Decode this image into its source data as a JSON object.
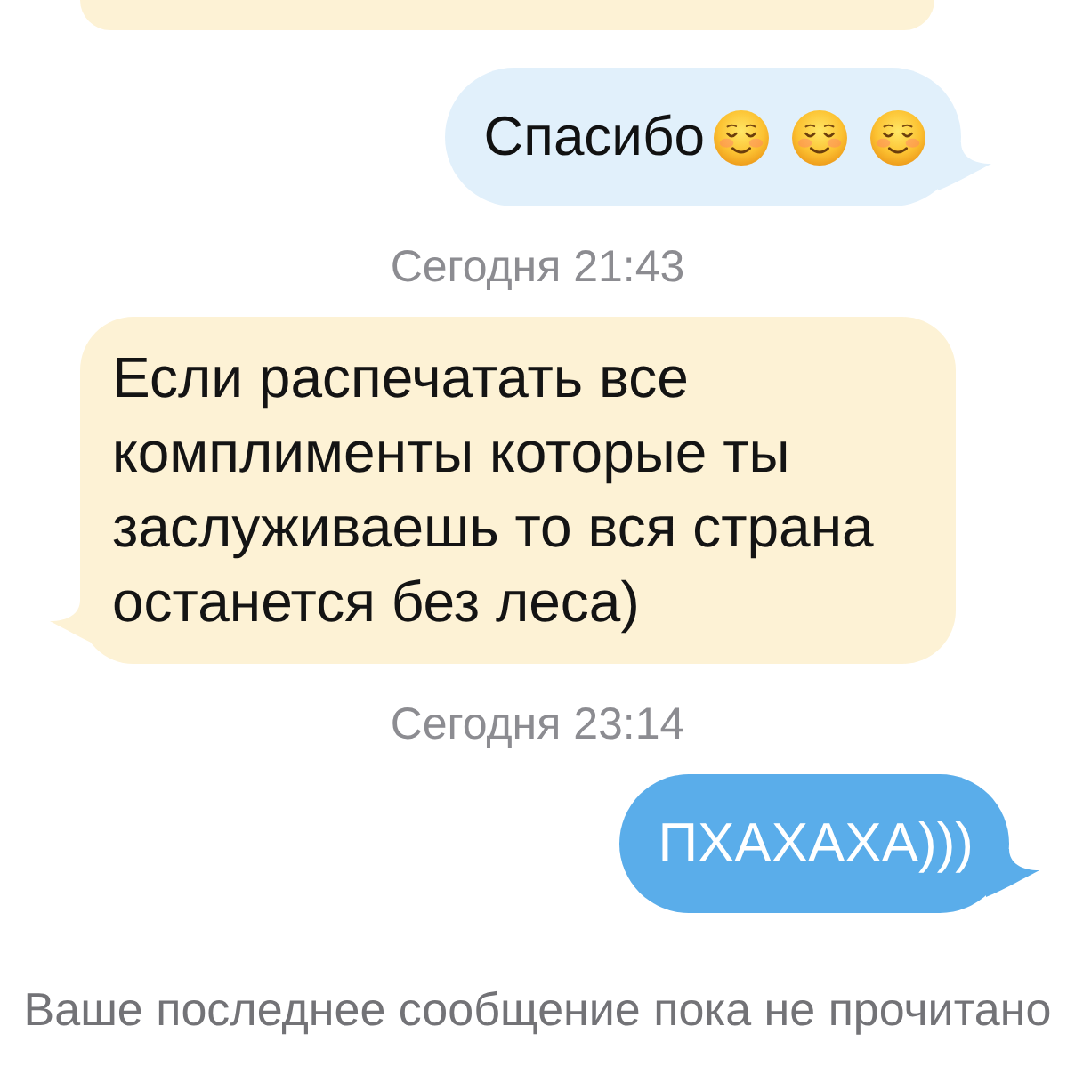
{
  "conversation": [
    {
      "kind": "message",
      "outgoing": false,
      "cut_off": true
    },
    {
      "kind": "message",
      "outgoing": true,
      "read": true,
      "text": "Спасибо",
      "emoji": [
        {
          "kind": "smiling-face"
        },
        {
          "kind": "smiling-face"
        },
        {
          "kind": "smiling-face"
        }
      ]
    },
    {
      "kind": "timestamp",
      "text": "Сегодня 21:43"
    },
    {
      "kind": "message",
      "outgoing": false,
      "text": "Если распечатать все комплименты которые ты заслуживаешь то вся страна останется без леса)"
    },
    {
      "kind": "timestamp",
      "text": "Сегодня 23:14"
    },
    {
      "kind": "message",
      "outgoing": true,
      "read": false,
      "text": "ПХАХАХА)))"
    }
  ],
  "status_line": "Ваше последнее сообщение пока не прочитано"
}
